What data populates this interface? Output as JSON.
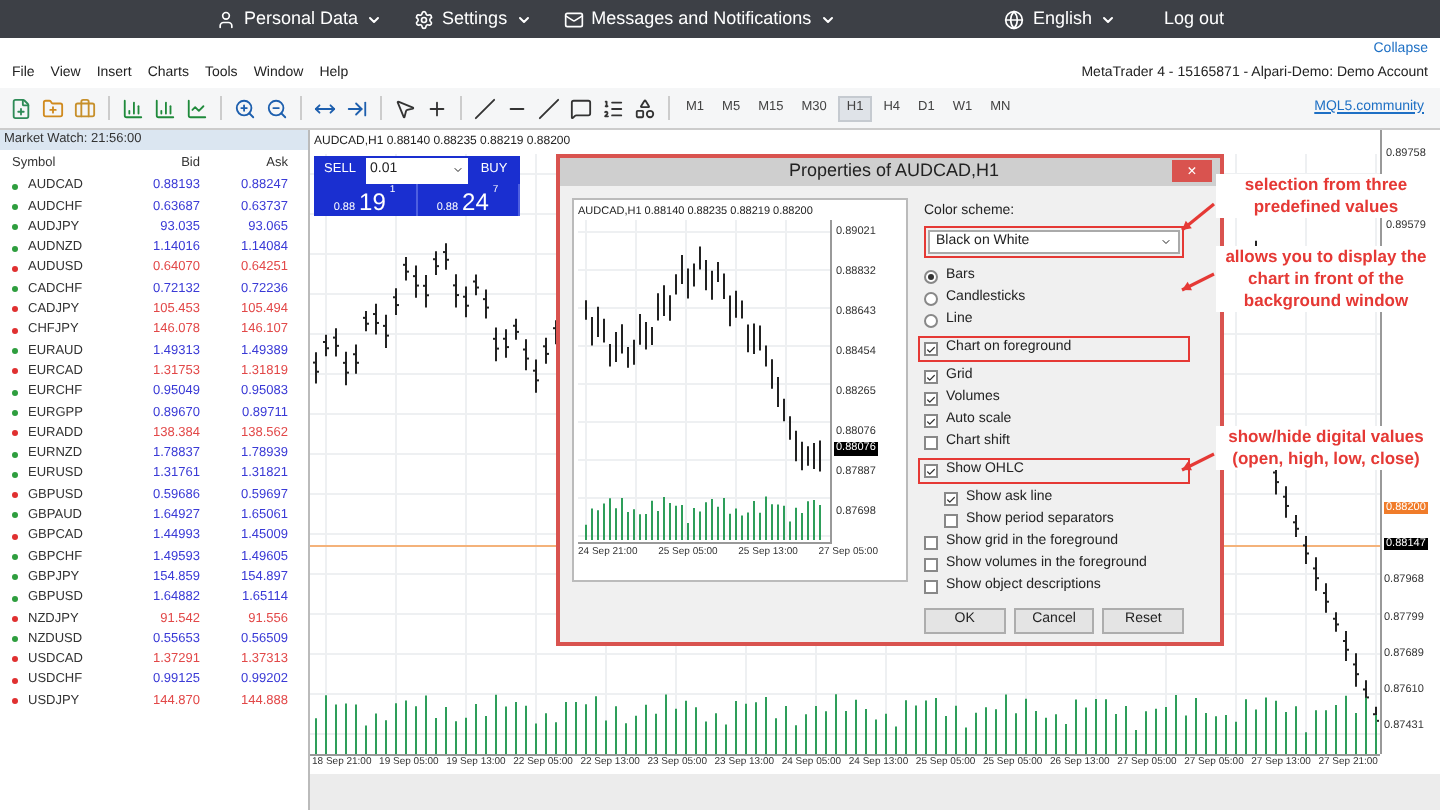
{
  "top_bar": {
    "left": [
      {
        "kind": "user",
        "label": "Personal Data",
        "dropdown": true
      },
      {
        "kind": "gear",
        "label": "Settings",
        "dropdown": true
      },
      {
        "kind": "mail",
        "label": "Messages and Notifications",
        "dropdown": true
      }
    ],
    "right": [
      {
        "kind": "globe",
        "label": "English",
        "dropdown": true
      },
      {
        "kind": "plain",
        "label": "Log out",
        "dropdown": false
      }
    ]
  },
  "collapse": "Collapse",
  "menu": [
    "File",
    "View",
    "Insert",
    "Charts",
    "Tools",
    "Window",
    "Help"
  ],
  "account": "MetaTrader 4 - 15165871 - Alpari-Demo: Demo Account",
  "timeframes": [
    {
      "label": "M1",
      "selected": false
    },
    {
      "label": "M5",
      "selected": false
    },
    {
      "label": "M15",
      "selected": false
    },
    {
      "label": "M30",
      "selected": false
    },
    {
      "label": "H1",
      "selected": true
    },
    {
      "label": "H4",
      "selected": false
    },
    {
      "label": "D1",
      "selected": false
    },
    {
      "label": "W1",
      "selected": false
    },
    {
      "label": "MN",
      "selected": false
    }
  ],
  "community_link": "MQL5.community",
  "market_watch": {
    "title": "Market Watch: 21:56:00",
    "columns": [
      "Symbol",
      "Bid",
      "Ask"
    ],
    "rows": [
      {
        "symbol": "AUDCAD",
        "bid": "0.88193",
        "ask": "0.88247",
        "color": "#2e9e3e",
        "kind": "up"
      },
      {
        "symbol": "AUDCHF",
        "bid": "0.63687",
        "ask": "0.63737",
        "color": "#2e9e3e",
        "kind": "up"
      },
      {
        "symbol": "AUDJPY",
        "bid": "93.035",
        "ask": "93.065",
        "color": "#2e9e3e",
        "kind": "up"
      },
      {
        "symbol": "AUDNZD",
        "bid": "1.14016",
        "ask": "1.14084",
        "color": "#2e9e3e",
        "kind": "up"
      },
      {
        "symbol": "AUDUSD",
        "bid": "0.64070",
        "ask": "0.64251",
        "color": "#e03030",
        "kind": "down"
      },
      {
        "symbol": "CADCHF",
        "bid": "0.72132",
        "ask": "0.72236",
        "color": "#2e9e3e",
        "kind": "up"
      },
      {
        "symbol": "CADJPY",
        "bid": "105.453",
        "ask": "105.494",
        "color": "#e03030",
        "kind": "down"
      },
      {
        "symbol": "CHFJPY",
        "bid": "146.078",
        "ask": "146.107",
        "color": "#e03030",
        "kind": "down"
      },
      {
        "symbol": "EURAUD",
        "bid": "1.49313",
        "ask": "1.49389",
        "color": "#2e9e3e",
        "kind": "up"
      },
      {
        "symbol": "EURCAD",
        "bid": "1.31753",
        "ask": "1.31819",
        "color": "#e03030",
        "kind": "down"
      },
      {
        "symbol": "EURCHF",
        "bid": "0.95049",
        "ask": "0.95083",
        "color": "#2e9e3e",
        "kind": "up"
      },
      {
        "symbol": "EURGPP",
        "bid": "0.89670",
        "ask": "0.89711",
        "color": "#2e9e3e",
        "kind": "up"
      },
      {
        "symbol": "EURADD",
        "bid": "138.384",
        "ask": "138.562",
        "color": "#e03030",
        "kind": "down"
      },
      {
        "symbol": "EURNZD",
        "bid": "1.78837",
        "ask": "1.78939",
        "color": "#2e9e3e",
        "kind": "up"
      },
      {
        "symbol": "EURUSD",
        "bid": "1.31761",
        "ask": "1.31821",
        "color": "#2e9e3e",
        "kind": "up"
      },
      {
        "symbol": "GBPUSD",
        "bid": "0.59686",
        "ask": "0.59697",
        "color": "#e03030",
        "kind": "up"
      },
      {
        "symbol": "GBPAUD",
        "bid": "1.64927",
        "ask": "1.65061",
        "color": "#2e9e3e",
        "kind": "up"
      },
      {
        "symbol": "GBPCAD",
        "bid": "1.44993",
        "ask": "1.45009",
        "color": "#e03030",
        "kind": "up"
      },
      {
        "symbol": "GBPCHF",
        "bid": "1.49593",
        "ask": "1.49605",
        "color": "#2e9e3e",
        "kind": "up"
      },
      {
        "symbol": "GBPJPY",
        "bid": "154.859",
        "ask": "154.897",
        "color": "#2e9e3e",
        "kind": "up"
      },
      {
        "symbol": "GBPUSD",
        "bid": "1.64882",
        "ask": "1.65114",
        "color": "#2e9e3e",
        "kind": "up"
      },
      {
        "symbol": "NZDJPY",
        "bid": "91.542",
        "ask": "91.556",
        "color": "#e03030",
        "kind": "down"
      },
      {
        "symbol": "NZDUSD",
        "bid": "0.55653",
        "ask": "0.56509",
        "color": "#2e9e3e",
        "kind": "up"
      },
      {
        "symbol": "USDCAD",
        "bid": "1.37291",
        "ask": "1.37313",
        "color": "#e03030",
        "kind": "down"
      },
      {
        "symbol": "USDCHF",
        "bid": "0.99125",
        "ask": "0.99202",
        "color": "#e03030",
        "kind": "up"
      },
      {
        "symbol": "USDJPY",
        "bid": "144.870",
        "ask": "144.888",
        "color": "#e03030",
        "kind": "down"
      }
    ]
  },
  "chart": {
    "header": "AUDCAD,H1  0.88140 0.88235 0.88219 0.88200",
    "trade_panel": {
      "sell": "SELL",
      "lot": "0.01",
      "buy": "BUY",
      "sell_price": {
        "prefix": "0.88",
        "big": "19",
        "sup": "1"
      },
      "buy_price": {
        "prefix": "0.88",
        "big": "24",
        "sup": "7"
      }
    },
    "price_axis_upper": [
      "0.89758",
      "0.89579"
    ],
    "price_axis_lower": [
      {
        "kind": "ask",
        "label": "0.88200"
      },
      {
        "kind": "bid",
        "label": "0.88147"
      },
      {
        "kind": "tick",
        "label": "0.87968"
      },
      {
        "kind": "tick",
        "label": "0.87799"
      },
      {
        "kind": "tick",
        "label": "0.87689"
      },
      {
        "kind": "tick",
        "label": "0.87610"
      },
      {
        "kind": "tick",
        "label": "0.87431"
      }
    ],
    "time_axis": [
      "18 Sep 21:00",
      "19 Sep 05:00",
      "19 Sep 13:00",
      "22 Sep 05:00",
      "22 Sep 13:00",
      "23 Sep 05:00",
      "23 Sep 13:00",
      "24 Sep 05:00",
      "24 Sep 13:00",
      "25 Sep 05:00",
      "25 Sep 05:00",
      "26 Sep 13:00",
      "27 Sep 05:00",
      "27 Sep 05:00",
      "27 Sep 13:00",
      "27 Sep 21:00"
    ]
  },
  "dialog": {
    "title": "Properties of AUDCAD,H1",
    "close": "×",
    "preview": {
      "header": "AUDCAD,H1  0.88140 0.88235 0.88219 0.88200",
      "price_axis": [
        "0.89021",
        "0.88832",
        "0.88643",
        "0.88454",
        "0.88265",
        "0.88076",
        "0.87887",
        "0.87698"
      ],
      "current_price": "0.88076",
      "time_axis": [
        "24 Sep 21:00",
        "25 Sep 05:00",
        "25 Sep 13:00",
        "27 Sep 05:00"
      ]
    },
    "color_scheme": {
      "label": "Color scheme:",
      "value": "Black on White",
      "annotated": true
    },
    "options": [
      {
        "kind": "radio",
        "label": "Bars",
        "selected": true
      },
      {
        "kind": "radio",
        "label": "Candlesticks",
        "selected": false
      },
      {
        "kind": "radio",
        "label": "Line",
        "selected": false
      },
      {
        "kind": "checkbox",
        "label": "Chart on foreground",
        "checked": true,
        "annotated": true
      },
      {
        "kind": "checkbox",
        "label": "Grid",
        "checked": true,
        "annotated": false
      },
      {
        "kind": "checkbox",
        "label": "Volumes",
        "checked": true,
        "annotated": false
      },
      {
        "kind": "checkbox",
        "label": "Auto scale",
        "checked": true,
        "annotated": false
      },
      {
        "kind": "checkbox",
        "label": "Chart shift",
        "checked": false,
        "annotated": false
      },
      {
        "kind": "checkbox",
        "label": "Show OHLC",
        "checked": true,
        "annotated": true,
        "children": [
          {
            "kind": "checkbox",
            "label": "Show ask line",
            "checked": true,
            "annotated": false
          },
          {
            "kind": "checkbox",
            "label": "Show period separators",
            "checked": false,
            "annotated": false
          }
        ]
      },
      {
        "kind": "checkbox",
        "label": "Show grid in the foreground",
        "checked": false,
        "annotated": false
      },
      {
        "kind": "checkbox",
        "label": "Show volumes in the foreground",
        "checked": false,
        "annotated": false
      },
      {
        "kind": "checkbox",
        "label": "Show object descriptions",
        "checked": false,
        "annotated": false
      }
    ],
    "buttons": [
      "OK",
      "Cancel",
      "Reset"
    ]
  },
  "annotations": [
    "selection from three predefined values",
    "allows you to display the chart in front of the background window",
    "show/hide digital values (open, high, low, close)"
  ]
}
